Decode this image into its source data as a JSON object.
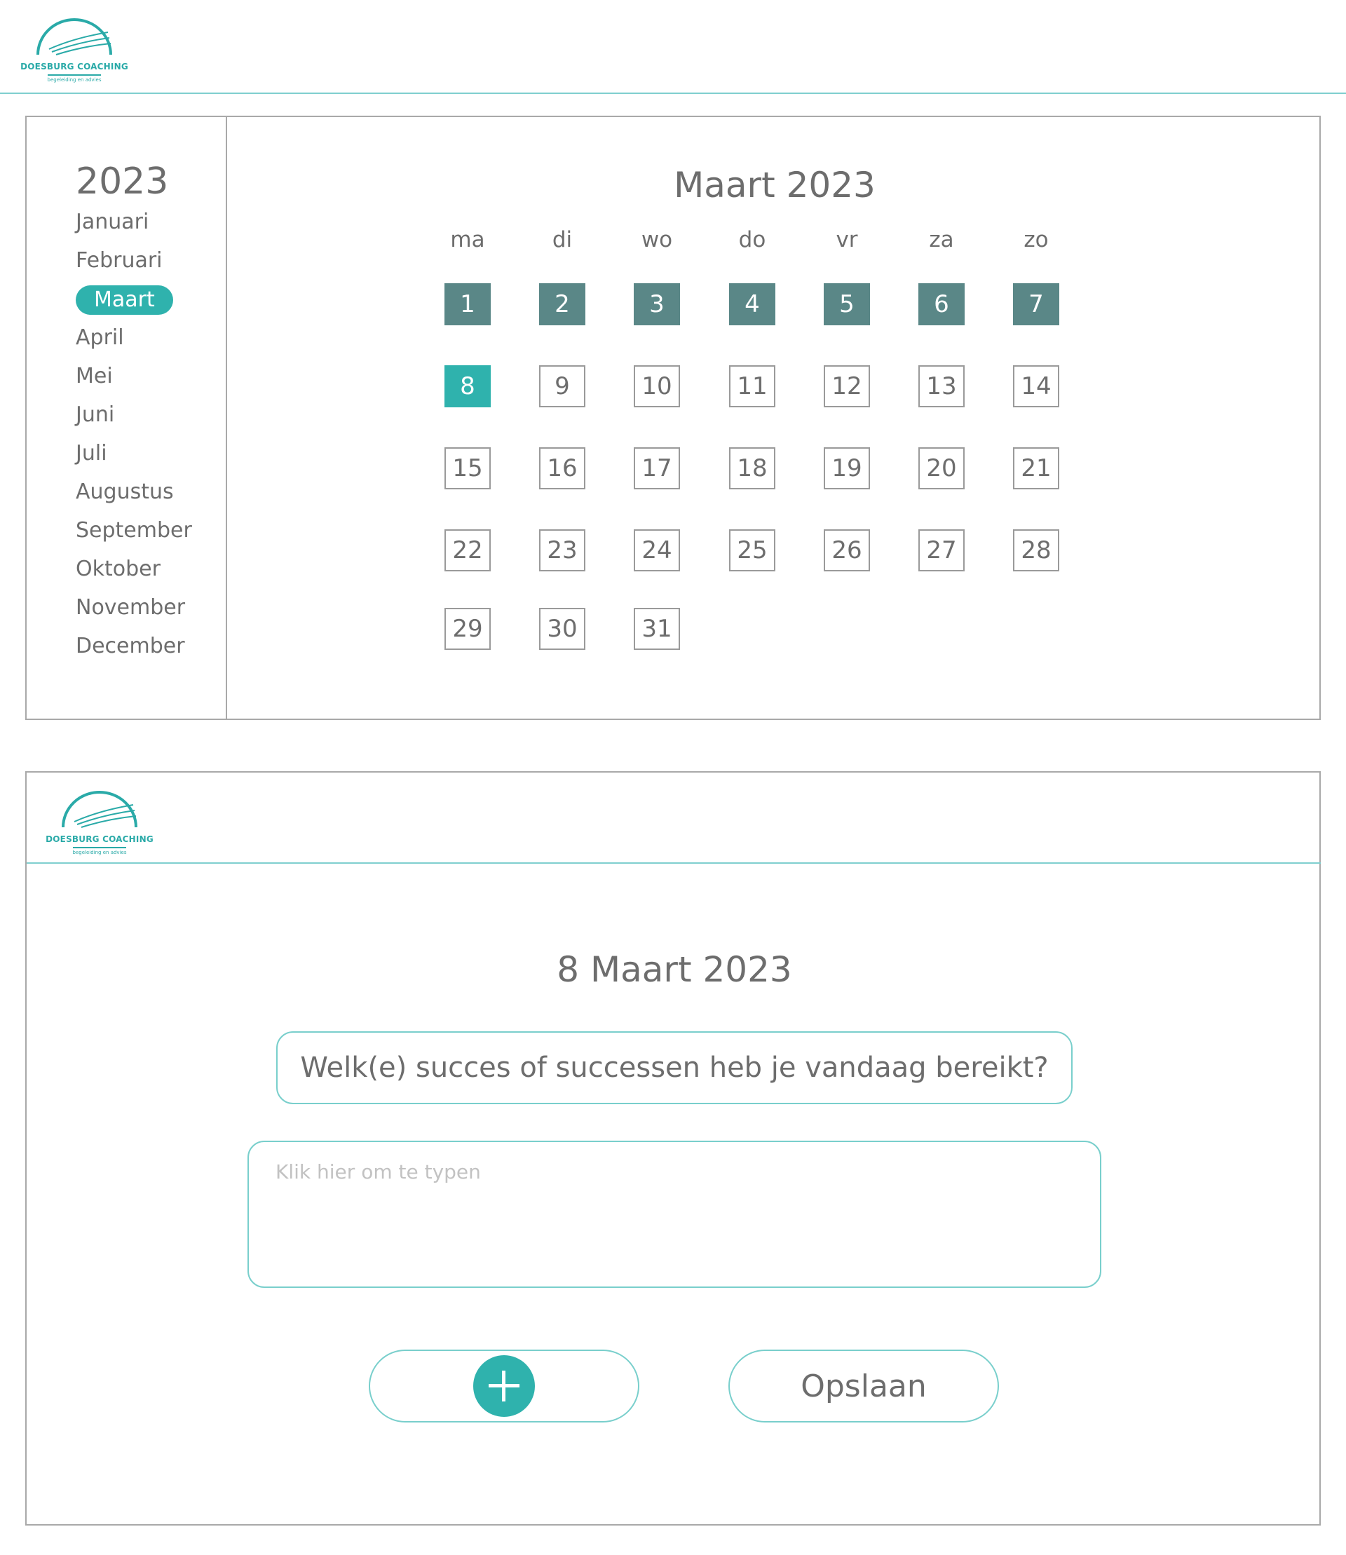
{
  "brand": {
    "name": "DOESBURG COACHING",
    "tagline": "begeleiding en advies",
    "color": "#2aaaa8"
  },
  "sidebar": {
    "year": "2023",
    "active_index": 2,
    "months": [
      "Januari",
      "Februari",
      "Maart",
      "April",
      "Mei",
      "Juni",
      "Juli",
      "Augustus",
      "September",
      "Oktober",
      "November",
      "December"
    ]
  },
  "calendar": {
    "title": "Maart 2023",
    "weekdays": [
      "ma",
      "di",
      "wo",
      "do",
      "vr",
      "za",
      "zo"
    ],
    "days": [
      "1",
      "2",
      "3",
      "4",
      "5",
      "6",
      "7",
      "8",
      "9",
      "10",
      "11",
      "12",
      "13",
      "14",
      "15",
      "16",
      "17",
      "18",
      "19",
      "20",
      "21",
      "22",
      "23",
      "24",
      "25",
      "26",
      "27",
      "28",
      "29",
      "30",
      "31"
    ],
    "completed_days": [
      "1",
      "2",
      "3",
      "4",
      "5",
      "6",
      "7"
    ],
    "today": "8",
    "colors": {
      "completed": "#5a8787",
      "today": "#2fb2ad"
    }
  },
  "entry": {
    "date": "8 Maart 2023",
    "question": "Welk(e) succes of successen heb je vandaag bereikt?",
    "input_placeholder": "Klik hier om te typen",
    "input_value": "",
    "add_icon": "plus-icon",
    "save_label": "Opslaan",
    "accent": "#2fb2ad"
  }
}
